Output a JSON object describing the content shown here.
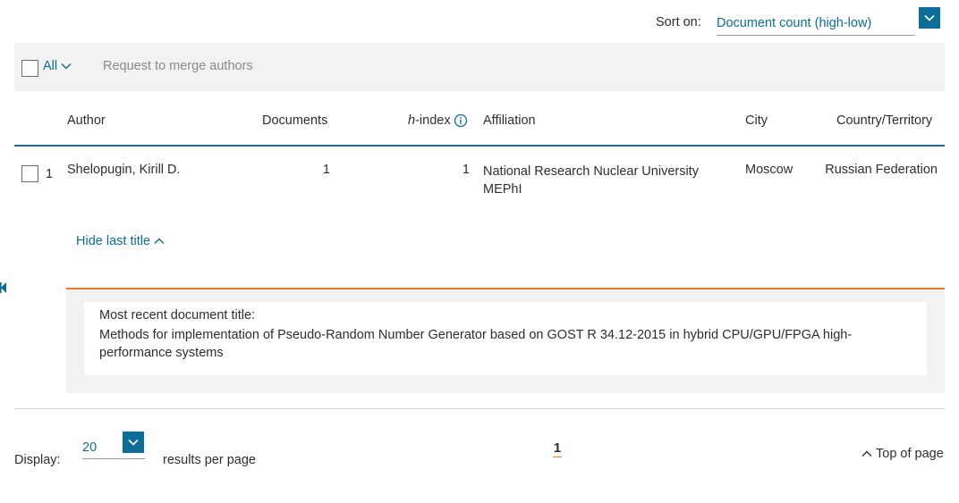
{
  "sort": {
    "label": "Sort on:",
    "value": "Document count (high-low)"
  },
  "toolbar": {
    "select_all_label": "All",
    "merge_label": "Request to merge authors"
  },
  "columns": {
    "author": "Author",
    "documents": "Documents",
    "hindex_italic": "h",
    "hindex_rest": "-index",
    "affiliation": "Affiliation",
    "city": "City",
    "country": "Country/Territory"
  },
  "rows": [
    {
      "index": "1",
      "author": "Shelopugin, Kirill D.",
      "documents": "1",
      "hindex": "1",
      "affiliation_line1": "National Research Nuclear University",
      "affiliation_line2": "MEPhI",
      "city": "Moscow",
      "country": "Russian Federation",
      "toggle_label": "Hide last title",
      "recent_title_label": "Most recent document title:",
      "recent_title_line1": "Methods for implementation of Pseudo-Random Number Generator based on GOST R 34.12-2015 in hybrid CPU/GPU/FPGA high-",
      "recent_title_line2": "performance systems"
    }
  ],
  "footer": {
    "display_label": "Display:",
    "per_page_value": "20",
    "per_page_suffix": "results per page",
    "current_page": "1",
    "top_of_page": "Top of page"
  },
  "colors": {
    "accent_blue": "#0c6e8f",
    "dropdown_blue": "#0c6d96",
    "active_orange": "#e8782a"
  },
  "icons": [
    "chevron-down-icon",
    "info-icon",
    "chevron-up-icon",
    "collapse-arrow-icon"
  ]
}
